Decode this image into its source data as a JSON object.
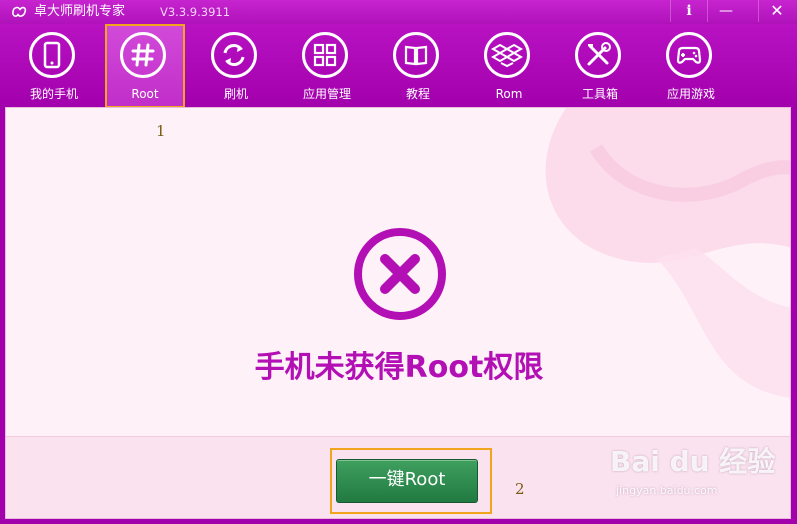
{
  "app": {
    "title": "卓大师刷机专家",
    "version": "V3.3.9.3911",
    "info_label": "i",
    "minimize_label": "—",
    "close_label": "✕"
  },
  "toolbar": {
    "items": [
      {
        "label": "我的手机",
        "icon": "phone-icon"
      },
      {
        "label": "Root",
        "icon": "hash-icon",
        "active": true
      },
      {
        "label": "刷机",
        "icon": "refresh-icon"
      },
      {
        "label": "应用管理",
        "icon": "apps-grid-icon"
      },
      {
        "label": "教程",
        "icon": "book-icon"
      },
      {
        "label": "Rom",
        "icon": "dropbox-icon"
      },
      {
        "label": "工具箱",
        "icon": "tools-icon"
      },
      {
        "label": "应用游戏",
        "icon": "gamepad-icon"
      }
    ]
  },
  "main": {
    "status_text": "手机未获得Root权限",
    "root_button_label": "一键Root",
    "status_icon": "error-x-icon"
  },
  "annotations": {
    "one": "1",
    "two": "2"
  },
  "watermark": {
    "main": "Bai du 经验",
    "sub": "jingyan.baidu.com"
  },
  "colors": {
    "primary": "#a300ad",
    "accent_text": "#b20fb5",
    "button_green": "#2d8c50",
    "highlight_outline": "#f0a51c"
  }
}
